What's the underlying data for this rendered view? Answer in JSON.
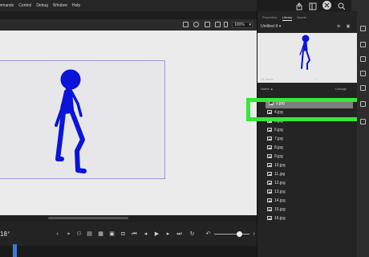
{
  "menu": [
    "mmands",
    "Control",
    "Debug",
    "Window",
    "Help"
  ],
  "stage": {
    "zoom": "100%"
  },
  "timeline": {
    "frame": "18",
    "frame_suffix": "F",
    "ruler_ticks": [
      "",
      "",
      "",
      "",
      "",
      "",
      "",
      "",
      "",
      ""
    ]
  },
  "panel": {
    "tabs": [
      "Properties",
      "Library",
      "Assets"
    ],
    "active_tab": "Library",
    "library_name": "Untitled-9",
    "items_count": "18 Items",
    "col_name": "Name ▲",
    "col_linkage": "Linkage",
    "items": [
      "2.jpg",
      "4.jpg",
      "5.jpg",
      "6.jpg",
      "7.jpg",
      "8.jpg",
      "9.jpg",
      "10.jpg",
      "11.jpg",
      "12.jpg",
      "13.jpg",
      "14.jpg",
      "15.jpg",
      "16.jpg"
    ],
    "selected_index": 0
  },
  "colors": {
    "highlight": "#39e63a",
    "figure": "#0b14d8"
  }
}
